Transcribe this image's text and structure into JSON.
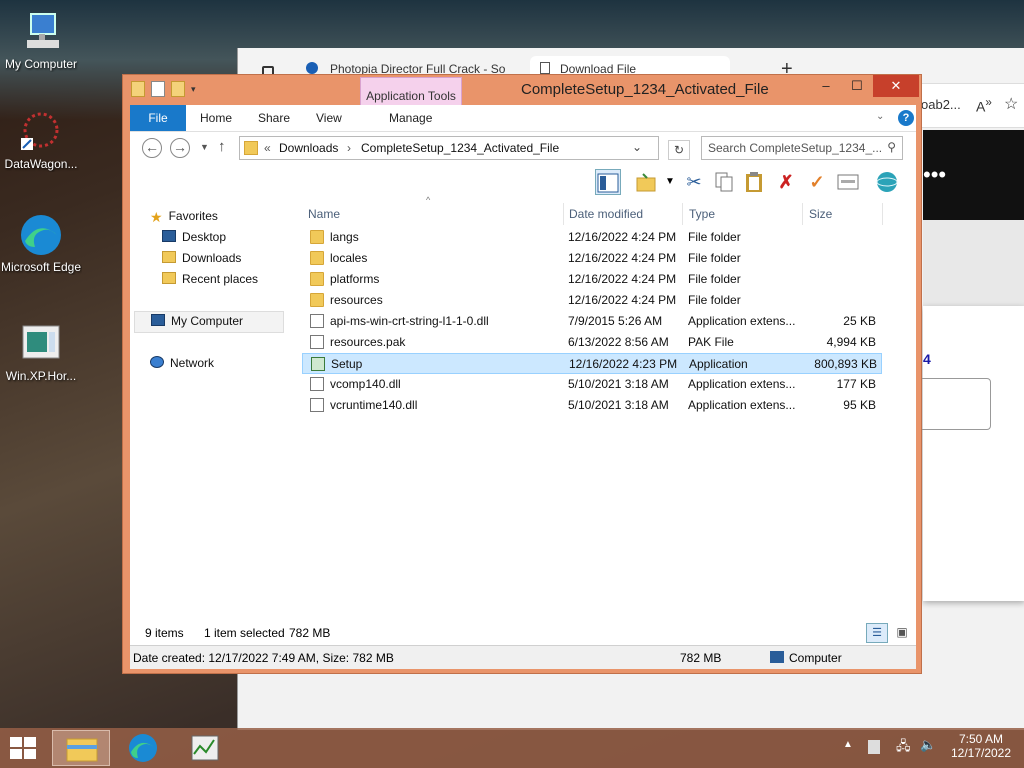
{
  "desktop": {
    "icons": [
      {
        "label": "My Computer"
      },
      {
        "label": "DataWagon..."
      },
      {
        "label": "Microsoft Edge"
      },
      {
        "label": "Win.XP.Hor..."
      }
    ]
  },
  "browser": {
    "tabs": [
      {
        "label": "Photopia Director Full Crack - So"
      },
      {
        "label": "Download File"
      }
    ],
    "new_tab": "+",
    "address_partial": "oab2...",
    "digit": "4",
    "ellipsis": "•••"
  },
  "explorer": {
    "title": "CompleteSetup_1234_Activated_File",
    "context_tab": "Application Tools",
    "ribbon_tabs": [
      "File",
      "Home",
      "Share",
      "View",
      "Manage"
    ],
    "window_buttons": {
      "minimize": "–",
      "maximize": "☐",
      "close": "✕"
    },
    "address": {
      "crumbs": [
        "Downloads",
        "CompleteSetup_1234_Activated_File"
      ],
      "prefix": "«"
    },
    "search": {
      "placeholder": "Search CompleteSetup_1234_..."
    },
    "nav": {
      "favorites": "Favorites",
      "desktop": "Desktop",
      "downloads": "Downloads",
      "recent": "Recent places",
      "computer": "My Computer",
      "network": "Network"
    },
    "columns": {
      "name": "Name",
      "date": "Date modified",
      "type": "Type",
      "size": "Size"
    },
    "files": [
      {
        "name": "langs",
        "date": "12/16/2022 4:24 PM",
        "type": "File folder",
        "size": "",
        "kind": "folder"
      },
      {
        "name": "locales",
        "date": "12/16/2022 4:24 PM",
        "type": "File folder",
        "size": "",
        "kind": "folder"
      },
      {
        "name": "platforms",
        "date": "12/16/2022 4:24 PM",
        "type": "File folder",
        "size": "",
        "kind": "folder"
      },
      {
        "name": "resources",
        "date": "12/16/2022 4:24 PM",
        "type": "File folder",
        "size": "",
        "kind": "folder"
      },
      {
        "name": "api-ms-win-crt-string-l1-1-0.dll",
        "date": "7/9/2015 5:26 AM",
        "type": "Application extens...",
        "size": "25 KB",
        "kind": "file"
      },
      {
        "name": "resources.pak",
        "date": "6/13/2022 8:56 AM",
        "type": "PAK File",
        "size": "4,994 KB",
        "kind": "file"
      },
      {
        "name": "Setup",
        "date": "12/16/2022 4:23 PM",
        "type": "Application",
        "size": "800,893 KB",
        "kind": "app",
        "selected": true
      },
      {
        "name": "vcomp140.dll",
        "date": "5/10/2021 3:18 AM",
        "type": "Application extens...",
        "size": "177 KB",
        "kind": "file"
      },
      {
        "name": "vcruntime140.dll",
        "date": "5/10/2021 3:18 AM",
        "type": "Application extens...",
        "size": "95 KB",
        "kind": "file"
      }
    ],
    "status": {
      "items": "9 items",
      "selected": "1 item selected",
      "selected_size": "782 MB"
    },
    "details": {
      "created": "Date created: 12/17/2022 7:49 AM, Size: 782 MB",
      "size": "782 MB",
      "location": "Computer"
    }
  },
  "taskbar": {
    "time": "7:50 AM",
    "date": "12/17/2022"
  },
  "colors": {
    "accent": "#1979ca",
    "window_frame": "#e9946a",
    "close": "#c7402b",
    "selection": "#cce8ff"
  }
}
